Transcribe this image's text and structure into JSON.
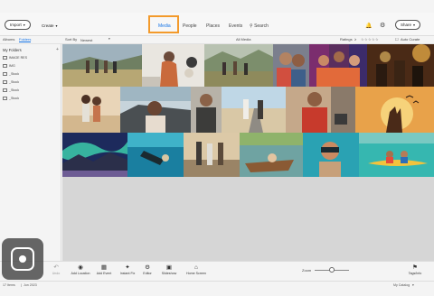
{
  "header": {
    "import_label": "Import",
    "create_label": "Create",
    "tabs": [
      {
        "label": "Media",
        "active": true
      },
      {
        "label": "People",
        "active": false
      },
      {
        "label": "Places",
        "active": false
      },
      {
        "label": "Events",
        "active": false
      }
    ],
    "search_label": "Search",
    "share_label": "Share",
    "highlight_color": "#f39a2b",
    "accent_color": "#1473e6"
  },
  "subbar": {
    "albums_label": "Albums",
    "folders_label": "Folders",
    "sortby_label": "Sort By",
    "sort_value": "Newest",
    "all_media_label": "All Media",
    "ratings_label": "Ratings",
    "ratings_op": "≥",
    "stars": "☆☆☆☆☆",
    "auto_curate_label": "Auto Curate"
  },
  "sidebar": {
    "title": "My Folders",
    "folders": [
      {
        "label": "IMAGE RES"
      },
      {
        "label": "IMG"
      },
      {
        "label": "_Stock"
      },
      {
        "label": "_Stock"
      },
      {
        "label": "_Stock"
      },
      {
        "label": "_Stock"
      }
    ]
  },
  "grid": {
    "tiles": [
      {
        "name": "friends-walking-field"
      },
      {
        "name": "woman-balloons"
      },
      {
        "name": "group-hiking"
      },
      {
        "name": "friends-selfie"
      },
      {
        "name": "party-colorful"
      },
      {
        "name": "concert-lights"
      },
      {
        "name": "couple-dancing-beach"
      },
      {
        "name": "woman-driving-car"
      },
      {
        "name": "man-street-portrait"
      },
      {
        "name": "couple-road-trip"
      },
      {
        "name": "man-red-shirt"
      },
      {
        "name": "hand-sunset-birds"
      },
      {
        "name": "aurora-mountains"
      },
      {
        "name": "scuba-diver"
      },
      {
        "name": "friends-pier"
      },
      {
        "name": "boat-water"
      },
      {
        "name": "snorkel-selfie"
      },
      {
        "name": "kayaking-couple"
      }
    ]
  },
  "toolbar": {
    "tools": [
      {
        "label": "Undo",
        "icon": "undo-icon"
      },
      {
        "label": "Add Location",
        "icon": "location-icon"
      },
      {
        "label": "Add Event",
        "icon": "calendar-icon"
      },
      {
        "label": "Instant Fix",
        "icon": "fix-icon"
      },
      {
        "label": "Editor",
        "icon": "editor-icon"
      },
      {
        "label": "Slideshow",
        "icon": "slideshow-icon"
      },
      {
        "label": "Home Screen",
        "icon": "home-icon"
      },
      {
        "label": "Tags/Info",
        "icon": "tag-icon"
      }
    ],
    "zoom_label": "Zoom",
    "zoom_level": 0.5
  },
  "status": {
    "count": "17 Items",
    "date": "Jun 2023",
    "catalog": "My Catalog"
  }
}
